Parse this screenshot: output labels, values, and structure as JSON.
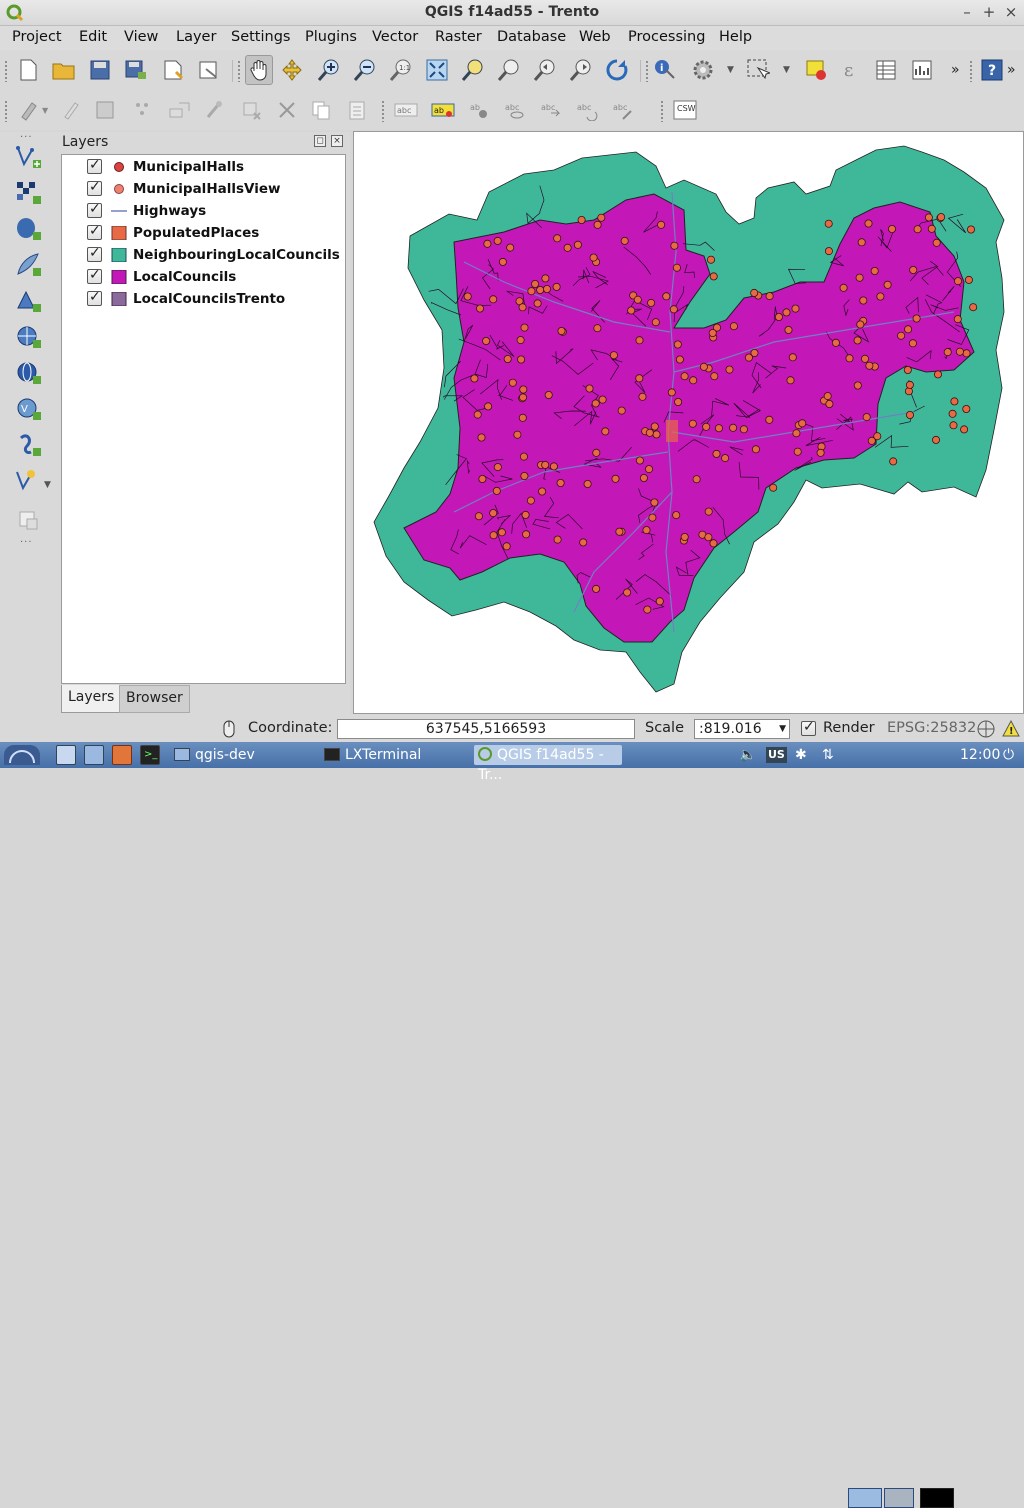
{
  "window": {
    "title": "QGIS f14ad55 - Trento"
  },
  "menu": [
    {
      "label": "Project",
      "u": "P"
    },
    {
      "label": "Edit",
      "u": "E"
    },
    {
      "label": "View",
      "u": "V"
    },
    {
      "label": "Layer",
      "u": "L"
    },
    {
      "label": "Settings",
      "u": "S"
    },
    {
      "label": "Plugins",
      "u": "P"
    },
    {
      "label": "Vector",
      "u": "o"
    },
    {
      "label": "Raster",
      "u": "R"
    },
    {
      "label": "Database",
      "u": "D"
    },
    {
      "label": "Web",
      "u": "W"
    },
    {
      "label": "Processing",
      "u": "P"
    },
    {
      "label": "Help",
      "u": "H"
    }
  ],
  "toolbar2": {
    "csw_label": "CSW",
    "more_label": "»"
  },
  "layers_panel": {
    "title": "Layers",
    "layers": [
      {
        "name": "MunicipalHalls",
        "symbol": "point",
        "color": "#e04040"
      },
      {
        "name": "MunicipalHallsView",
        "symbol": "point",
        "color": "#f08070"
      },
      {
        "name": "Highways",
        "symbol": "line",
        "color": "#7080c0"
      },
      {
        "name": "PopulatedPlaces",
        "symbol": "fill",
        "color": "#e86a44"
      },
      {
        "name": "NeighbouringLocalCouncils",
        "symbol": "fill",
        "color": "#3fb89a"
      },
      {
        "name": "LocalCouncils",
        "symbol": "fill",
        "color": "#c417b8"
      },
      {
        "name": "LocalCouncilsTrento",
        "symbol": "fill",
        "color": "#8a6a9a"
      }
    ],
    "tabs": [
      {
        "label": "Layers"
      },
      {
        "label": "Browser"
      }
    ]
  },
  "statusbar": {
    "coordinate_label": "Coordinate:",
    "coordinate_value": "637545,5166593",
    "scale_label": "Scale",
    "scale_value": ":819.016",
    "render_label": "Render",
    "crs": "EPSG:25832"
  },
  "taskbar": {
    "items": [
      {
        "label": "qgis-dev"
      },
      {
        "label": "LXTerminal"
      },
      {
        "label": "QGIS f14ad55 - Tr..."
      }
    ],
    "keyboard": "US",
    "clock": "12:00"
  },
  "colors": {
    "local_councils": "#c417b8",
    "neighbouring": "#3fb89a",
    "halls": "#e86a44",
    "highways": "#7080c0"
  }
}
